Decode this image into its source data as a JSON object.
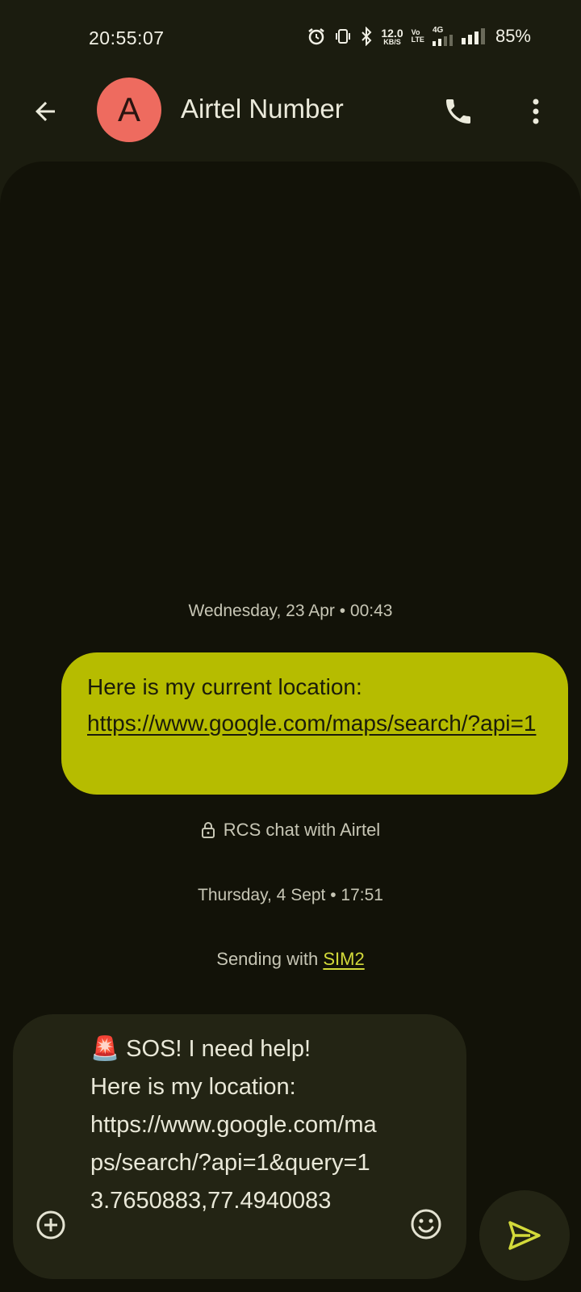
{
  "status_bar": {
    "time": "20:55:07",
    "net_speed_value": "12.0",
    "net_speed_unit": "KB/S",
    "volte_top": "Vo",
    "volte_bottom": "LTE",
    "network_type": "4G",
    "battery": "85%",
    "icons": [
      "alarm-icon",
      "vibrate-icon",
      "bluetooth-icon",
      "signal-sim1-icon",
      "signal-sim2-icon"
    ]
  },
  "header": {
    "avatar_letter": "A",
    "avatar_color": "#ee6b5f",
    "contact_name": "Airtel Number",
    "icons": [
      "back-arrow-icon",
      "phone-icon",
      "more-vert-icon"
    ]
  },
  "conversation": {
    "date_1": "Wednesday, 23 Apr • 00:43",
    "message_1": {
      "line_1": "Here is my current location:",
      "link": "https://www.google.com/maps/search/?api=1"
    },
    "rcs_notice": "RCS chat with Airtel",
    "date_2": "Thursday, 4 Sept • 17:51",
    "sending_prefix": "Sending with ",
    "sending_sim": "SIM2"
  },
  "compose": {
    "draft_text": "🚨 SOS! I need help!\nHere is my location:\nhttps://www.google.com/maps/search/?api=1&query=13.7650883,77.4940083",
    "icons": [
      "add-circle-icon",
      "emoji-icon",
      "send-icon"
    ]
  },
  "colors": {
    "background": "#1b1c0f",
    "panel": "#121208",
    "bubble_out": "#b6bc00",
    "accent": "#d3da3a",
    "compose": "#232414"
  }
}
